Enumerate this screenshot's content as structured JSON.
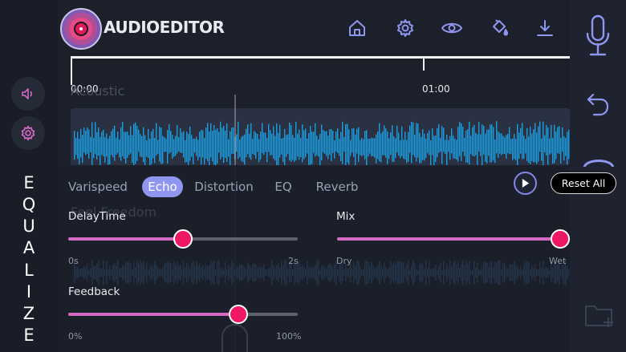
{
  "app": {
    "logo_text": "AUDIOEDITOR"
  },
  "timeline": {
    "start_label": "00:00",
    "mid_label": "01:00"
  },
  "tracks": [
    {
      "name": "Acoustic"
    },
    {
      "name": "Feel Freedom"
    }
  ],
  "effects_panel": {
    "side_label": [
      "E",
      "Q",
      "U",
      "A",
      "L",
      "I",
      "Z",
      "E"
    ],
    "tabs": [
      {
        "label": "Varispeed",
        "active": false
      },
      {
        "label": "Echo",
        "active": true
      },
      {
        "label": "Distortion",
        "active": false
      },
      {
        "label": "EQ",
        "active": false
      },
      {
        "label": "Reverb",
        "active": false
      }
    ],
    "reset_label": "Reset All",
    "sliders": {
      "delay_time": {
        "label": "DelayTime",
        "min_label": "0s",
        "max_label": "2s",
        "value_fraction": 0.5
      },
      "mix": {
        "label": "Mix",
        "min_label": "Dry",
        "max_label": "Wet",
        "value_fraction": 1.0
      },
      "feedback": {
        "label": "Feedback",
        "min_label": "0%",
        "max_label": "100%",
        "value_fraction": 0.74
      }
    }
  },
  "icons": {
    "header": [
      "home-icon",
      "gear-icon",
      "eye-icon",
      "paint-bucket-icon",
      "download-icon"
    ],
    "right_rail": [
      "microphone-icon",
      "undo-icon",
      "folder-add-icon"
    ],
    "left_rail": [
      "speaker-icon",
      "gear-icon"
    ]
  },
  "colors": {
    "accent": "#8f96f0",
    "thumb": "#ee1865",
    "fill": "#d46ac4",
    "wave": "#1a9ee0",
    "icon": "#8f96f0"
  }
}
